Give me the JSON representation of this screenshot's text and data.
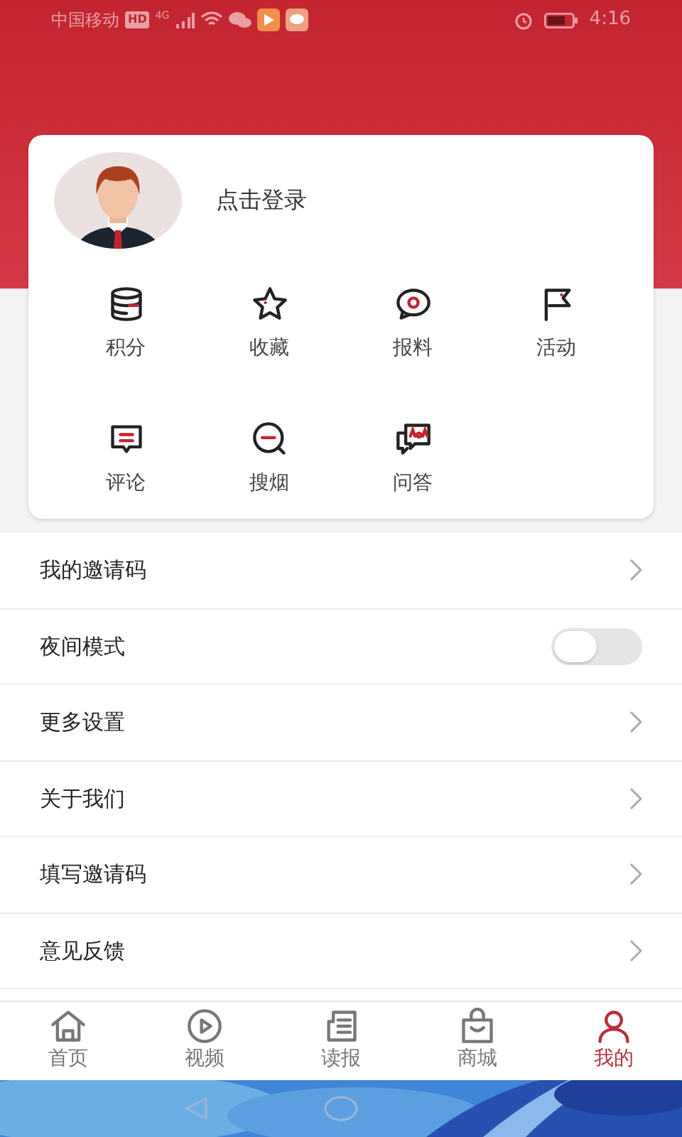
{
  "status_bar": {
    "carrier": "中国移动",
    "hd": "HD",
    "network": "4G",
    "time": "4:16"
  },
  "profile": {
    "login_text": "点击登录"
  },
  "shortcuts": [
    {
      "label": "积分"
    },
    {
      "label": "收藏"
    },
    {
      "label": "报料"
    },
    {
      "label": "活动"
    },
    {
      "label": "评论"
    },
    {
      "label": "搜烟"
    },
    {
      "label": "问答"
    }
  ],
  "menu": [
    {
      "label": "我的邀请码",
      "kind": "link"
    },
    {
      "label": "夜间模式",
      "kind": "toggle",
      "on": false
    },
    {
      "label": "更多设置",
      "kind": "link"
    },
    {
      "label": "关于我们",
      "kind": "link"
    },
    {
      "label": "填写邀请码",
      "kind": "link"
    },
    {
      "label": "意见反馈",
      "kind": "link"
    }
  ],
  "tab_bar": [
    {
      "label": "首页",
      "selected": false
    },
    {
      "label": "视频",
      "selected": false
    },
    {
      "label": "读报",
      "selected": false
    },
    {
      "label": "商城",
      "selected": false
    },
    {
      "label": "我的",
      "selected": true
    }
  ]
}
